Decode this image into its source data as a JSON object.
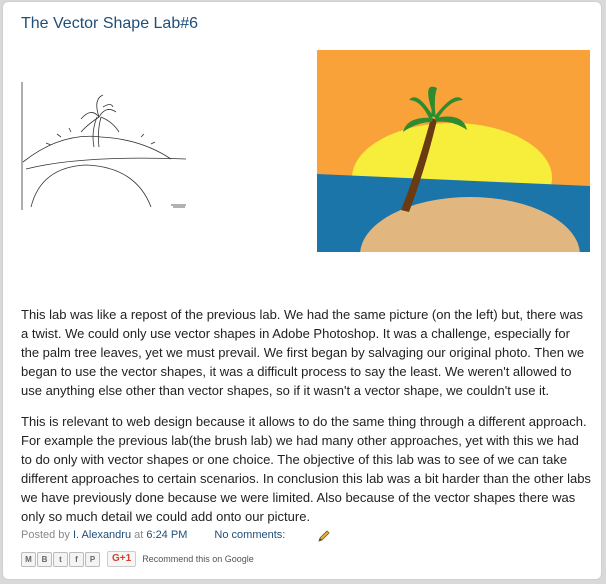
{
  "post": {
    "title": "The Vector Shape Lab#6",
    "paragraph1": "This lab was like a repost of the previous lab. We had the same picture (on the left) but, there was a twist.  We could only use vector shapes in Adobe Photoshop. It was a challenge, especially for the palm tree leaves, yet we must prevail.  We first began by salvaging our original photo. Then we began to use the vector shapes, it was a difficult process to say the least. We weren't allowed to use anything else other than vector shapes, so if it wasn't a vector shape, we couldn't use it.",
    "paragraph2": "This is relevant to web design because it allows to do the same thing through a different approach. For example the previous lab(the brush lab) we had many other approaches, yet with this we had to do only with vector shapes or one choice. The objective of this lab was to see of we can take different approaches to certain scenarios. In conclusion this lab was a bit harder than the other labs we have previously done because we were limited. Also because of the vector shapes there was only so much detail we could add onto our picture."
  },
  "footer": {
    "posted_by_label": "Posted by",
    "author": "I. Alexandru",
    "at_label": "at",
    "time": "6:24 PM",
    "comments": "No comments:"
  },
  "share": {
    "buttons": [
      "email-icon",
      "blogthis-icon",
      "twitter-icon",
      "facebook-icon",
      "pinterest-icon"
    ],
    "gplus_label": "G+1",
    "recommend_text": "Recommend this on Google"
  },
  "colors": {
    "sky": "#F9A23A",
    "sun": "#F7EE3C",
    "sea": "#1B75A8",
    "sand": "#E2B77F",
    "trunk": "#6A3A12",
    "leaves": "#2E8B2E",
    "link": "#1F4E79"
  }
}
